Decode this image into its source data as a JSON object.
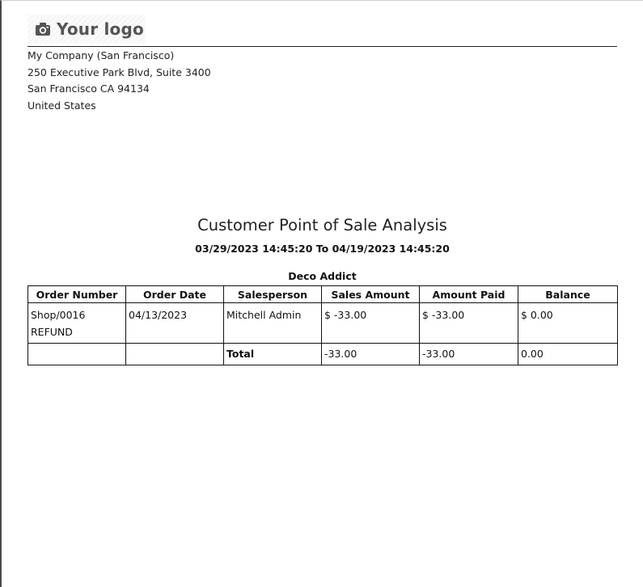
{
  "header": {
    "logo_text": "Your logo",
    "logo_icon": "camera-icon",
    "address_lines": [
      "My Company (San Francisco)",
      "250 Executive Park Blvd, Suite 3400",
      "San Francisco CA 94134",
      "United States"
    ]
  },
  "report": {
    "title": "Customer Point of Sale Analysis",
    "date_range": "03/29/2023 14:45:20 To 04/19/2023 14:45:20",
    "customer": "Deco Addict",
    "columns": [
      "Order Number",
      "Order Date",
      "Salesperson",
      "Sales Amount",
      "Amount Paid",
      "Balance"
    ],
    "rows": [
      {
        "order_number": "Shop/0016\nREFUND",
        "order_date": "04/13/2023",
        "salesperson": "Mitchell Admin",
        "sales_amount": "$ -33.00",
        "amount_paid": "$ -33.00",
        "balance": "$ 0.00"
      }
    ],
    "totals": {
      "label": "Total",
      "sales_amount": "-33.00",
      "amount_paid": "-33.00",
      "balance": "0.00"
    }
  },
  "colors": {
    "text": "#111111",
    "logo_text": "#555555",
    "border": "#111111"
  }
}
